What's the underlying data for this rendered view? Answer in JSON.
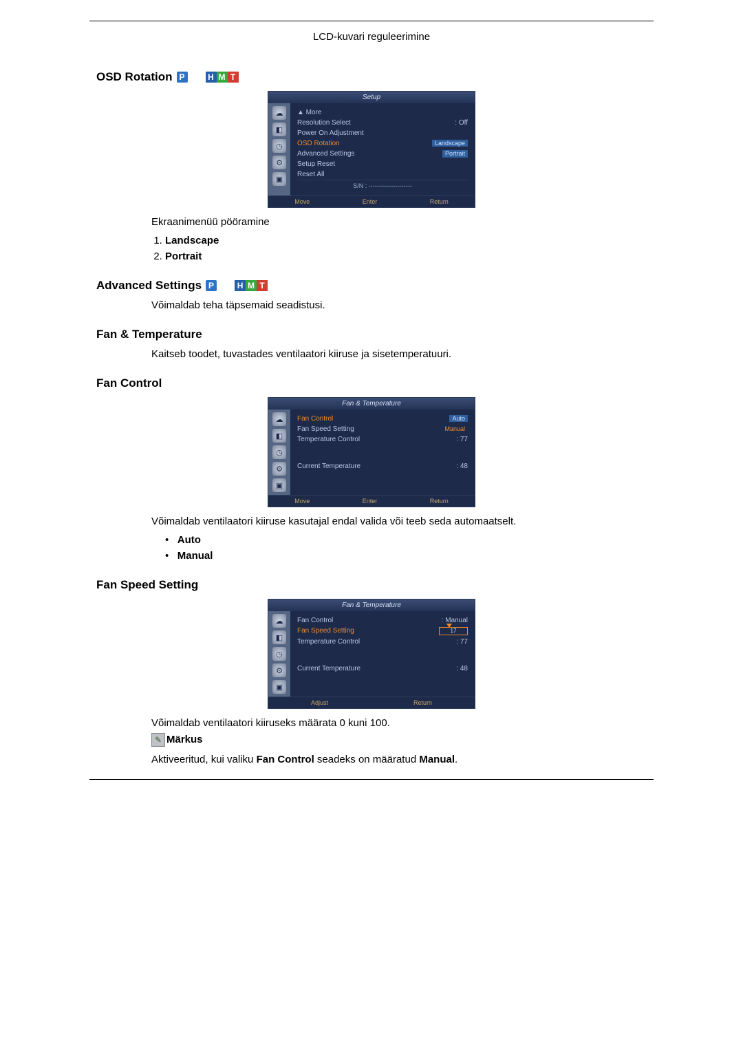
{
  "header": {
    "title": "LCD-kuvari reguleerimine"
  },
  "sections": {
    "osd_rotation": {
      "heading": "OSD Rotation",
      "desc": "Ekraanimenüü pööramine",
      "items": [
        "Landscape",
        "Portrait"
      ]
    },
    "advanced_settings": {
      "heading": "Advanced Settings",
      "desc": "Võimaldab teha täpsemaid seadistusi."
    },
    "fan_temp": {
      "heading": "Fan & Temperature",
      "desc": "Kaitseb toodet, tuvastades ventilaatori kiiruse ja sisetemperatuuri."
    },
    "fan_control": {
      "heading": "Fan Control",
      "desc": "Võimaldab ventilaatori kiiruse kasutajal endal valida või teeb seda automaatselt.",
      "items": [
        "Auto",
        "Manual"
      ]
    },
    "fan_speed": {
      "heading": "Fan Speed Setting",
      "desc": "Võimaldab ventilaatori kiiruseks määrata 0 kuni 100.",
      "note_label": "Märkus",
      "note_text_pre": "Aktiveeritud, kui valiku ",
      "note_text_mid": "Fan Control",
      "note_text_mid2": " seadeks on määratud ",
      "note_text_end": "Manual",
      "note_text_period": "."
    }
  },
  "osd_setup": {
    "title": "Setup",
    "more": "▲ More",
    "rows": {
      "resolution": {
        "label": "Resolution Select",
        "value": ": Off"
      },
      "poweron": {
        "label": "Power On Adjustment"
      },
      "osdrot": {
        "label": "OSD Rotation",
        "opt1": "Landscape",
        "opt2": "Portrait"
      },
      "advset": {
        "label": "Advanced Settings"
      },
      "reset": {
        "label": "Setup Reset"
      },
      "resetall": {
        "label": "Reset All"
      }
    },
    "sn": "S/N : ---------------------",
    "foot": {
      "move": "Move",
      "enter": "Enter",
      "return": "Return"
    }
  },
  "osd_fan1": {
    "title": "Fan & Temperature",
    "rows": {
      "fc": {
        "label": "Fan Control",
        "opt1": "Auto",
        "opt2": "Manual"
      },
      "fss": {
        "label": "Fan Speed Setting"
      },
      "tc": {
        "label": "Temperature Control",
        "value": ": 77"
      },
      "ct": {
        "label": "Current Temperature",
        "value": ": 48"
      }
    },
    "foot": {
      "move": "Move",
      "enter": "Enter",
      "return": "Return"
    }
  },
  "osd_fan2": {
    "title": "Fan & Temperature",
    "rows": {
      "fc": {
        "label": "Fan Control",
        "value": ": Manual"
      },
      "fss": {
        "label": "Fan Speed Setting",
        "value": "17"
      },
      "tc": {
        "label": "Temperature Control",
        "value": ": 77"
      },
      "ct": {
        "label": "Current Temperature",
        "value": ": 48"
      }
    },
    "foot": {
      "adjust": "Adjust",
      "return": "Return"
    }
  },
  "badge_text": {
    "p": "P",
    "h": "H",
    "m": "M",
    "t": "T"
  }
}
